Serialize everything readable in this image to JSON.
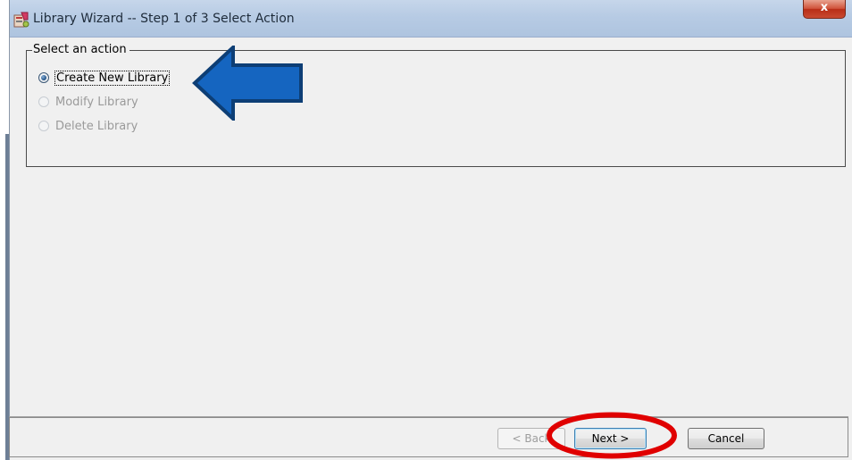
{
  "window": {
    "title": "Library Wizard  -- Step 1 of 3  Select Action",
    "close_label": "x"
  },
  "group": {
    "legend": "Select an action",
    "options": [
      {
        "label": "Create New Library",
        "checked": true,
        "enabled": true
      },
      {
        "label": "Modify Library",
        "checked": false,
        "enabled": false
      },
      {
        "label": "Delete Library",
        "checked": false,
        "enabled": false
      }
    ]
  },
  "buttons": {
    "back_label": "< Back",
    "next_label": "Next >",
    "cancel_label": "Cancel"
  },
  "colors": {
    "arrow_fill": "#1565c0",
    "arrow_outline": "#0d3e75",
    "highlight_ellipse": "#e00000",
    "close_button": "#c94a31"
  },
  "icons": {
    "app": "library-wizard-app-icon",
    "close": "close-icon"
  }
}
